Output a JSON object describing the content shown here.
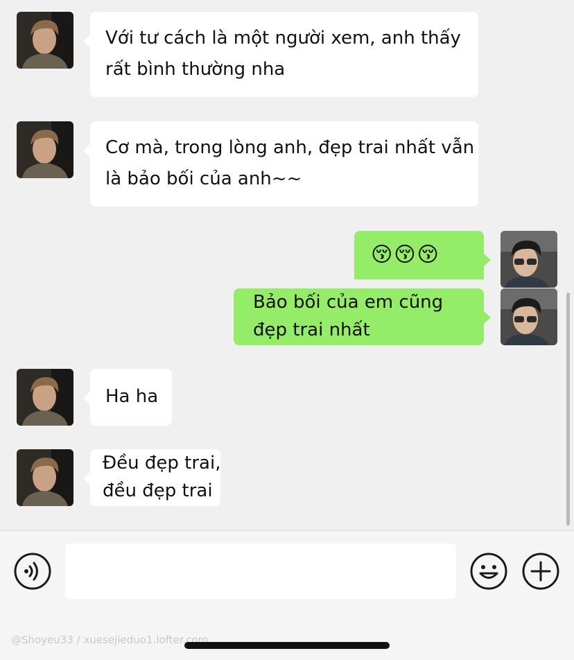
{
  "messages": [
    {
      "side": "in",
      "lines": [
        "Với tư cách là một người xem, anh thấy",
        "rất bình thường nha"
      ]
    },
    {
      "side": "in",
      "lines": [
        "Cơ mà, trong lòng anh, đẹp trai nhất vẫn",
        "là bảo bối của anh~~"
      ]
    },
    {
      "side": "out",
      "lines": [
        "😚😚😚"
      ]
    },
    {
      "side": "out",
      "lines": [
        "Bảo bối của em cũng",
        "đẹp trai nhất"
      ]
    },
    {
      "side": "in",
      "lines": [
        "Ha ha"
      ]
    },
    {
      "side": "in",
      "lines": [
        "Đều đẹp trai,",
        "đều đẹp trai"
      ]
    }
  ],
  "input_bar": {
    "voice_icon": "voice-icon",
    "emoji_icon": "smiley-icon",
    "add_icon": "plus-icon",
    "text_value": ""
  },
  "watermark": "@Shoyeu33 / xuesejieduo1.lofter.com",
  "colors": {
    "background": "#f0f0f0",
    "incoming_bubble": "#ffffff",
    "outgoing_bubble": "#95ec69"
  }
}
